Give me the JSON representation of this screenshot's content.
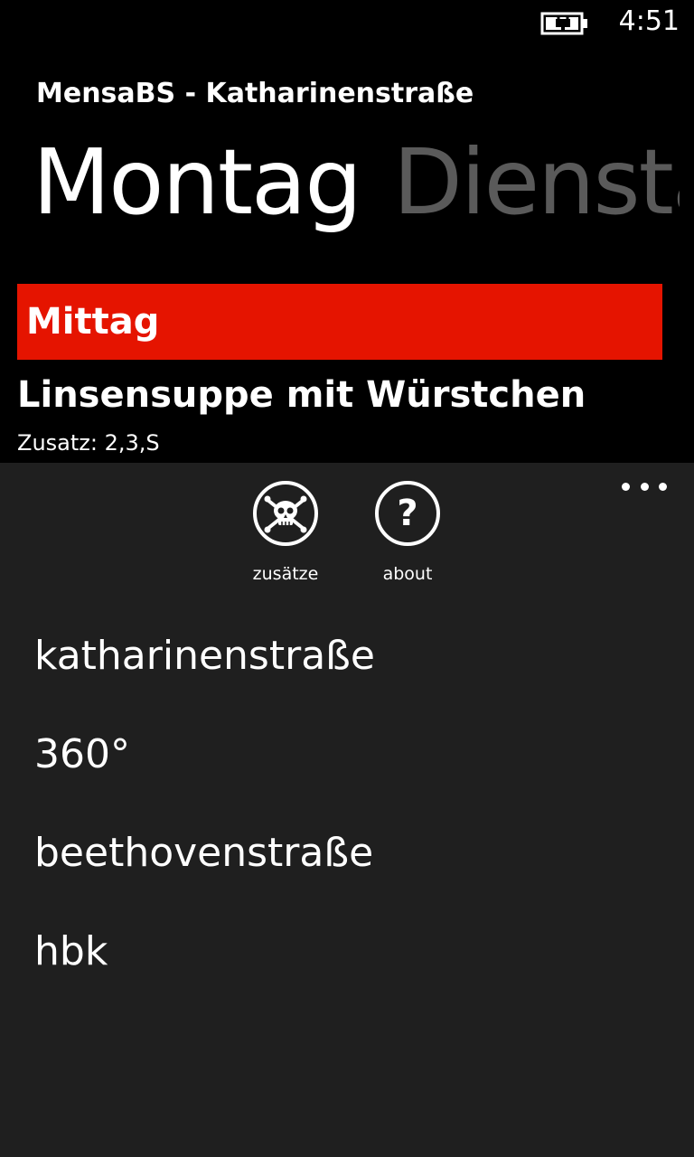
{
  "status_bar": {
    "clock": "4:51",
    "battery_icon": "battery-charging-icon"
  },
  "app_title": "MensaBS - Katharinenstraße",
  "pivot": {
    "headers": [
      "Montag",
      "Dienstag"
    ],
    "active_index": 0
  },
  "content": {
    "section_label": "Mittag",
    "section_color": "#e51400",
    "meal_title": "Linsensuppe mit Würstchen",
    "meal_additives": "Zusatz: 2,3,S"
  },
  "app_bar": {
    "background": "#1f1f1f",
    "buttons": [
      {
        "label": "zusätze",
        "icon": "skull-crossbones-icon"
      },
      {
        "label": "about",
        "icon": "question-mark-icon"
      }
    ],
    "more_icon": "ellipsis-icon",
    "menu_items": [
      "katharinenstraße",
      "360°",
      "beethovenstraße",
      "hbk"
    ]
  }
}
